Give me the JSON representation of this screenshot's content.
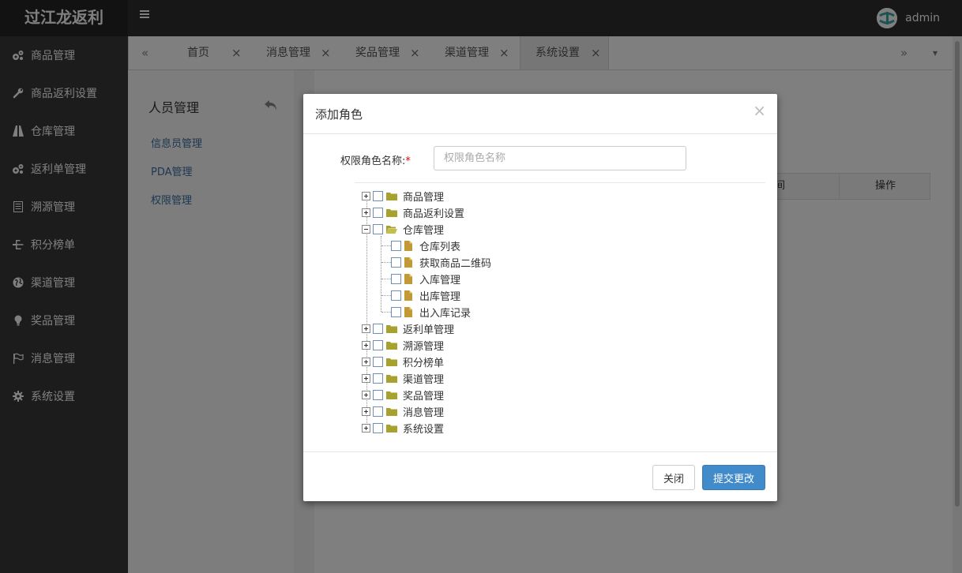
{
  "brand": "过江龙返利",
  "user": {
    "name": "admin"
  },
  "sidebar": {
    "items": [
      {
        "label": "商品管理",
        "icon": "cogs-icon"
      },
      {
        "label": "商品返利设置",
        "icon": "wrench-icon"
      },
      {
        "label": "仓库管理",
        "icon": "road-icon"
      },
      {
        "label": "返利单管理",
        "icon": "cogs-icon"
      },
      {
        "label": "溯源管理",
        "icon": "list-icon"
      },
      {
        "label": "积分榜单",
        "icon": "sitemap-icon"
      },
      {
        "label": "渠道管理",
        "icon": "globe-icon"
      },
      {
        "label": "奖品管理",
        "icon": "lightbulb-icon"
      },
      {
        "label": "消息管理",
        "icon": "flag-icon"
      },
      {
        "label": "系统设置",
        "icon": "gear-icon"
      }
    ]
  },
  "tabs": {
    "prev": "«",
    "next": "»",
    "menu": "▾",
    "close": "×",
    "items": [
      {
        "label": "首页"
      },
      {
        "label": "消息管理"
      },
      {
        "label": "奖品管理"
      },
      {
        "label": "渠道管理"
      },
      {
        "label": "系统设置"
      }
    ]
  },
  "left_panel": {
    "title": "人员管理",
    "links": [
      "信息员管理",
      "PDA管理",
      "权限管理"
    ]
  },
  "background_table": {
    "headers": [
      "间",
      "操作"
    ]
  },
  "modal": {
    "title": "添加角色",
    "close": "×",
    "role_label": "权限角色名称:",
    "required_mark": "*",
    "role_placeholder": "权限角色名称",
    "role_value": "",
    "tree": [
      {
        "label": "商品管理"
      },
      {
        "label": "商品返利设置"
      },
      {
        "label": "仓库管理",
        "expanded": true,
        "children": [
          "仓库列表",
          "获取商品二维码",
          "入库管理",
          "出库管理",
          "出入库记录"
        ]
      },
      {
        "label": "返利单管理"
      },
      {
        "label": "溯源管理"
      },
      {
        "label": "积分榜单"
      },
      {
        "label": "渠道管理"
      },
      {
        "label": "奖品管理"
      },
      {
        "label": "消息管理"
      },
      {
        "label": "系统设置"
      }
    ],
    "buttons": {
      "close": "关闭",
      "submit": "提交更改"
    }
  },
  "colors": {
    "primary": "#428bca",
    "sidebar": "#393939",
    "topbar": "#2f2f2f",
    "folder": "#a6a22d",
    "file": "#c29a35",
    "link": "#3b6fa5"
  }
}
